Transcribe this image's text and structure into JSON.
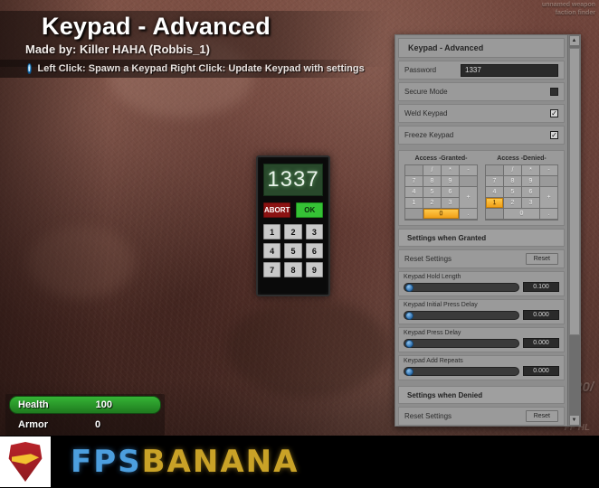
{
  "header": {
    "title": "Keypad - Advanced",
    "subtitle": "Made by: Killer HAHA (Robbis_1)",
    "info_icon": "info-icon",
    "hint": "Left Click: Spawn a Keypad   Right Click: Update Keypad with settings"
  },
  "corner_hud": {
    "line1": "unnamed weapon",
    "line2": "faction finder"
  },
  "ammo_hud": {
    "value": "20/",
    "sub": "FF HL"
  },
  "keypad_prop": {
    "display": "1337",
    "abort_label": "ABORT",
    "ok_label": "OK",
    "keys": [
      "1",
      "2",
      "3",
      "4",
      "5",
      "6",
      "7",
      "8",
      "9"
    ]
  },
  "hud": {
    "health_label": "Health",
    "health_value": "100",
    "armor_label": "Armor",
    "armor_value": "0",
    "health_color": "#35b435"
  },
  "watermark": {
    "fps": "FPS",
    "banana": "BANANA",
    "logo": "superman-shield-logo"
  },
  "panel": {
    "title": "Keypad - Advanced",
    "password": {
      "label": "Password",
      "value": "1337"
    },
    "toggles": [
      {
        "label": "Secure Mode",
        "checked": false
      },
      {
        "label": "Weld Keypad",
        "checked": true
      },
      {
        "label": "Freeze Keypad",
        "checked": true
      }
    ],
    "grids": [
      {
        "title": "Access -Granted-",
        "keys": [
          "",
          "/",
          "*",
          "-",
          "7",
          "8",
          "9",
          "",
          "4",
          "5",
          "6",
          "+",
          "1",
          "2",
          "3",
          "",
          "0",
          ".",
          "",
          ""
        ],
        "highlight": "0"
      },
      {
        "title": "Access -Denied-",
        "keys": [
          "",
          "/",
          "*",
          "-",
          "7",
          "8",
          "9",
          "",
          "4",
          "5",
          "6",
          "+",
          "1",
          "2",
          "3",
          "",
          "0",
          ".",
          "",
          ""
        ],
        "highlight": "1"
      }
    ],
    "granted_section": {
      "heading": "Settings when Granted",
      "reset_label": "Reset Settings",
      "reset_button": "Reset",
      "sliders": [
        {
          "label": "Keypad Hold Length",
          "value": "0.100"
        },
        {
          "label": "Keypad Initial Press Delay",
          "value": "0.000"
        },
        {
          "label": "Keypad Press Delay",
          "value": "0.000"
        },
        {
          "label": "Keypad Add Repeats",
          "value": "0.000"
        }
      ]
    },
    "denied_section": {
      "heading": "Settings when Denied",
      "reset_label": "Reset Settings",
      "reset_button": "Reset"
    },
    "scrollbar": {
      "up": "▲",
      "down": "▼"
    }
  }
}
